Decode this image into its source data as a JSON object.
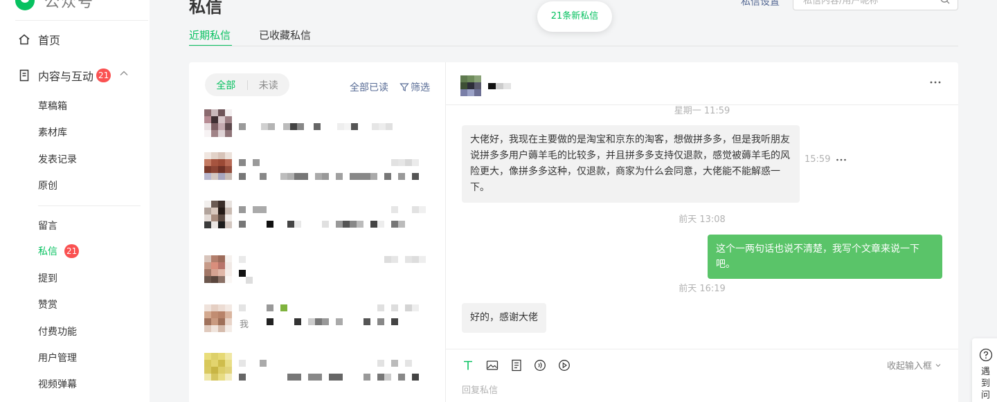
{
  "brand": {
    "name": "公众号"
  },
  "sidebar": {
    "home_label": "首页",
    "content": {
      "label": "内容与互动",
      "badge": "21"
    },
    "content_items": [
      "草稿箱",
      "素材库",
      "发表记录",
      "原创"
    ],
    "interaction_items": [
      "留言",
      "私信",
      "提到",
      "赞赏",
      "付费功能",
      "用户管理",
      "视频弹幕"
    ],
    "messages_badge": "21",
    "active_item": "私信"
  },
  "header": {
    "title": "私信",
    "settings_link": "私信设置",
    "search_placeholder": "私信内容/用户昵称",
    "toast": "21条新私信"
  },
  "tabs": {
    "recent": "近期私信",
    "starred": "已收藏私信"
  },
  "list": {
    "filter_all": "全部",
    "filter_unread": "未读",
    "mark_all_read": "全部已读",
    "filter_label": "筛选",
    "preview_fragment": "我"
  },
  "chat": {
    "times": [
      "星期一 11:59",
      "前天 13:08",
      "前天 16:19"
    ],
    "incoming_1": "大佬好，我现在主要做的是淘宝和京东的淘客，想做拼多多，但是我听朋友说拼多多用户薅羊毛的比较多，并且拼多多支持仅退款，感觉被薅羊毛的风险更大，像拼多多这种，仅退款，商家为什么会同意，大佬能不能解惑一下。",
    "incoming_1_time": "15:59",
    "outgoing_1": "这个一两句话也说不清楚，我写个文章来说一下吧。",
    "incoming_2": "好的，感谢大佬",
    "composer_collapse": "收起输入框",
    "reply_placeholder": "回复私信"
  },
  "help": {
    "label": "遇到问题"
  },
  "colors": {
    "accent": "#07c160",
    "badge": "#fa5151",
    "link": "#576b95"
  }
}
